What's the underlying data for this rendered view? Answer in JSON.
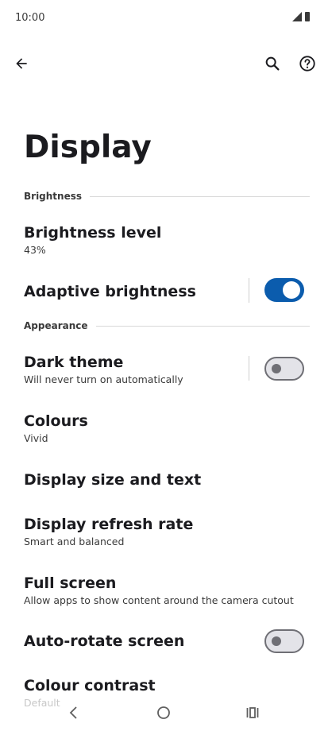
{
  "status_bar": {
    "time": "10:00",
    "icons": [
      "signal-icon",
      "battery-icon"
    ]
  },
  "toolbar": {
    "icons": [
      "back-arrow-icon",
      "search-icon",
      "help-icon"
    ]
  },
  "page": {
    "title": "Display"
  },
  "sections": [
    {
      "header": "Brightness"
    },
    {
      "header": "Appearance"
    }
  ],
  "settings": {
    "brightness_level": {
      "title": "Brightness level",
      "value": "43%"
    },
    "adaptive_brightness": {
      "title": "Adaptive brightness",
      "enabled": true
    },
    "dark_theme": {
      "title": "Dark theme",
      "summary": "Will never turn on automatically",
      "enabled": false
    },
    "colours": {
      "title": "Colours",
      "value": "Vivid"
    },
    "display_size": {
      "title": "Display size and text"
    },
    "refresh_rate": {
      "title": "Display refresh rate",
      "value": "Smart and balanced"
    },
    "full_screen": {
      "title": "Full screen",
      "summary": "Allow apps to show content around the camera cutout"
    },
    "auto_rotate": {
      "title": "Auto-rotate screen",
      "enabled": false
    },
    "colour_contrast": {
      "title": "Colour contrast",
      "value": "Default"
    }
  },
  "nav_bar": {
    "icons": [
      "nav-back-icon",
      "home-icon",
      "recents-icon"
    ]
  },
  "colors": {
    "accent": "#0b5cad",
    "text": "#1b1b1f",
    "secondary_text": "#3a3a3a",
    "background": "#ffffff"
  }
}
